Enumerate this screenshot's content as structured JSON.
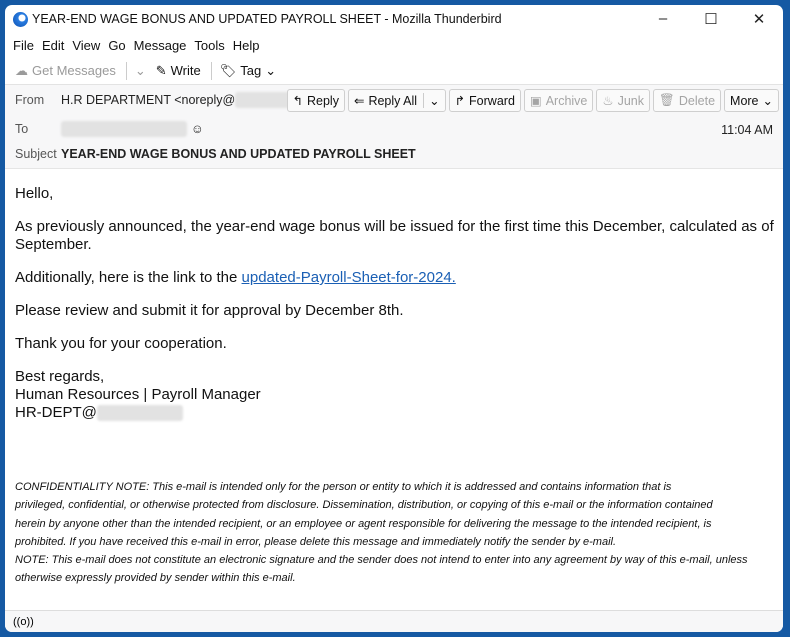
{
  "window": {
    "title": "YEAR-END WAGE BONUS AND UPDATED PAYROLL SHEET - Mozilla Thunderbird",
    "minimize": "–",
    "maximize": "☐",
    "close": "✕"
  },
  "menu": [
    "File",
    "Edit",
    "View",
    "Go",
    "Message",
    "Tools",
    "Help"
  ],
  "toolbar": {
    "get_messages": "Get Messages",
    "write": "Write",
    "tag": "Tag"
  },
  "header": {
    "from_label": "From",
    "from_value": "H.R DEPARTMENT <noreply@",
    "from_end": ">",
    "to_label": "To",
    "time": "11:04 AM",
    "subject_label": "Subject",
    "subject": "YEAR-END WAGE BONUS AND UPDATED PAYROLL SHEET",
    "buttons": {
      "reply": "Reply",
      "reply_all": "Reply All",
      "forward": "Forward",
      "archive": "Archive",
      "junk": "Junk",
      "delete": "Delete",
      "more": "More"
    }
  },
  "body": {
    "greeting": "Hello,",
    "p1": "As previously announced, the year-end wage bonus will be issued for the first time this December, calculated as of September.",
    "p2_prefix": "Additionally, here is the link to the ",
    "p2_link": "updated-Payroll-Sheet-for-2024.",
    "p3": "Please review and submit it for approval by December 8th.",
    "p4": "Thank you for your cooperation.",
    "sign1": "Best regards,",
    "sign2": "Human Resources | Payroll Manager",
    "sign3": "HR-DEPT@"
  },
  "disclaimer": {
    "l1": "CONFIDENTIALITY NOTE: This e-mail is intended only for the person or entity to which it is addressed and contains information that is",
    "l2": "privileged, confidential, or otherwise protected from disclosure. Dissemination, distribution, or copying of this e-mail or the information contained",
    "l3": "herein by anyone other than the intended recipient, or an employee or agent responsible for delivering the message to the intended recipient, is",
    "l4": "prohibited. If you have received this e-mail in error, please delete this message and immediately notify the sender by e-mail.",
    "l5": "NOTE: This e-mail does not constitute an electronic signature and the sender does not intend to enter into any agreement by way of this e-mail, unless",
    "l6": "otherwise expressly provided by sender within this e-mail."
  },
  "status": {
    "icon": "((o))"
  }
}
